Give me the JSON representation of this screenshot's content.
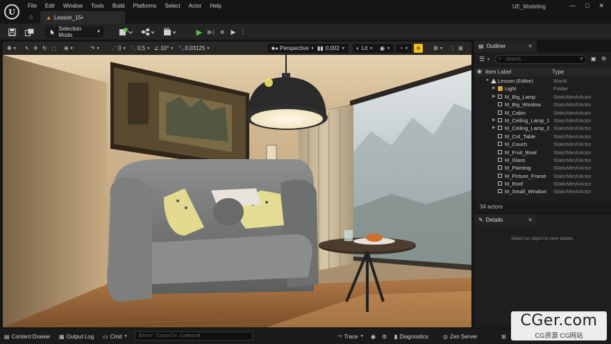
{
  "menu": [
    "File",
    "Edit",
    "Window",
    "Tools",
    "Build",
    "Platforms",
    "Select",
    "Actor",
    "Help"
  ],
  "document_tab": "Lesson_15•",
  "project_name": "UE_Modeling",
  "window_controls": {
    "minimize": "—",
    "maximize": "□",
    "close": "✕"
  },
  "toolbar": {
    "selection_mode": "Selection Mode"
  },
  "viewport_toolbar": {
    "rotate_snap_a": "0",
    "scale_value": "0,5",
    "rotate_snap": "10°",
    "scale_snap": "0,03125",
    "view_mode": "Perspective",
    "camera_speed": "0,002",
    "lighting": "Lit"
  },
  "outliner": {
    "tab": "Outliner",
    "search_placeholder": "Search...",
    "col_label": "Item Label",
    "col_type": "Type",
    "rows": [
      {
        "name": "Lesson (Editor)",
        "type": "World",
        "indent": 0,
        "arrow": "▼",
        "icon": "level"
      },
      {
        "name": "Light",
        "type": "Folder",
        "indent": 1,
        "arrow": "▶",
        "icon": "folder"
      },
      {
        "name": "M_Big_Lamp",
        "type": "StaticMeshActor",
        "indent": 1,
        "arrow": "▶",
        "icon": "mesh"
      },
      {
        "name": "M_Big_Window",
        "type": "StaticMeshActor",
        "indent": 1,
        "arrow": "",
        "icon": "mesh"
      },
      {
        "name": "M_Cabin",
        "type": "StaticMeshActor",
        "indent": 1,
        "arrow": "",
        "icon": "mesh"
      },
      {
        "name": "M_Ceiling_Lamp_1",
        "type": "StaticMeshActor",
        "indent": 1,
        "arrow": "▶",
        "icon": "mesh"
      },
      {
        "name": "M_Ceiling_Lamp_2",
        "type": "StaticMeshActor",
        "indent": 1,
        "arrow": "▶",
        "icon": "mesh"
      },
      {
        "name": "M_Cof_Table",
        "type": "StaticMeshActor",
        "indent": 1,
        "arrow": "",
        "icon": "mesh"
      },
      {
        "name": "M_Couch",
        "type": "StaticMeshActor",
        "indent": 1,
        "arrow": "",
        "icon": "mesh"
      },
      {
        "name": "M_Fruit_Bowl",
        "type": "StaticMeshActor",
        "indent": 1,
        "arrow": "",
        "icon": "mesh"
      },
      {
        "name": "M_Glass",
        "type": "StaticMeshActor",
        "indent": 1,
        "arrow": "",
        "icon": "mesh"
      },
      {
        "name": "M_Painting",
        "type": "StaticMeshActor",
        "indent": 1,
        "arrow": "",
        "icon": "mesh"
      },
      {
        "name": "M_Picture_Frame",
        "type": "StaticMeshActor",
        "indent": 1,
        "arrow": "",
        "icon": "mesh"
      },
      {
        "name": "M_Roof",
        "type": "StaticMeshActor",
        "indent": 1,
        "arrow": "",
        "icon": "mesh"
      },
      {
        "name": "M_Small_Window",
        "type": "StaticMeshActor",
        "indent": 1,
        "arrow": "",
        "icon": "mesh"
      }
    ],
    "actor_count": "34 actors"
  },
  "details": {
    "tab": "Details",
    "empty_message": "Select an object to view details."
  },
  "statusbar": {
    "content_drawer": "Content Drawer",
    "output_log": "Output Log",
    "cmd": "Cmd",
    "console_placeholder": "Enter Console Command",
    "trace": "Trace",
    "diagnostics": "Diagnostics",
    "zen_server": "Zen Server"
  },
  "watermark": {
    "main": "CGer.com",
    "sub": "CG资源 CG网站"
  },
  "colors": {
    "accent_play": "#5ec24a",
    "snap_active": "#f0c020",
    "folder": "#d9a441",
    "panel_bg": "#1e1e1e"
  }
}
